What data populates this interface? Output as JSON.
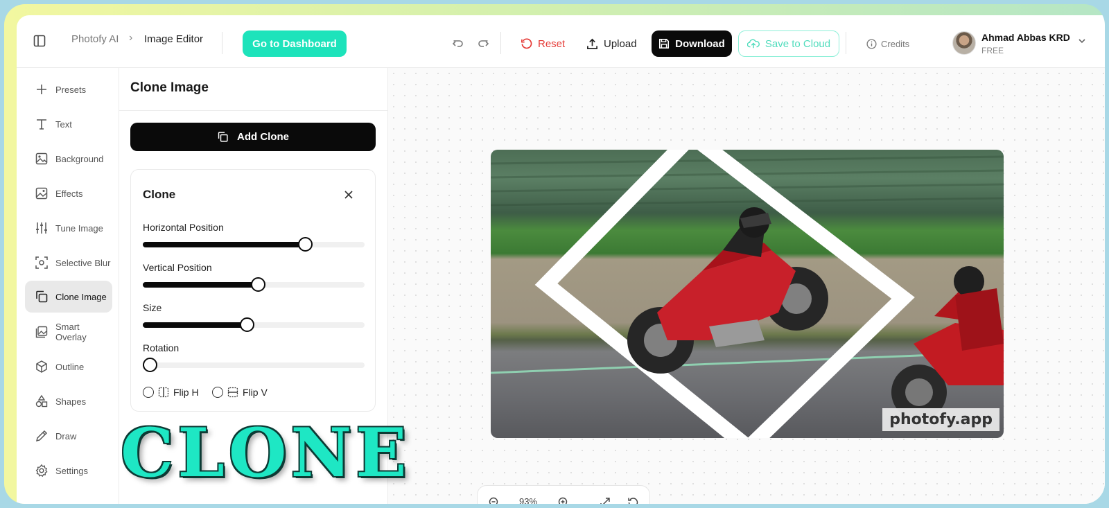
{
  "header": {
    "app_name": "Photofy AI",
    "page_name": "Image Editor",
    "dashboard_button": "Go to Dashboard",
    "reset_label": "Reset",
    "upload_label": "Upload",
    "download_label": "Download",
    "cloud_label": "Save to Cloud",
    "credits_label": "Credits",
    "user_name": "Ahmad Abbas KRD",
    "user_plan": "FREE"
  },
  "sidebar": {
    "items": [
      {
        "label": "Presets",
        "icon": "plus-icon"
      },
      {
        "label": "Text",
        "icon": "text-icon"
      },
      {
        "label": "Background",
        "icon": "image-icon"
      },
      {
        "label": "Effects",
        "icon": "sparkle-image-icon"
      },
      {
        "label": "Tune Image",
        "icon": "sliders-icon"
      },
      {
        "label": "Selective Blur",
        "icon": "focus-icon"
      },
      {
        "label": "Clone Image",
        "icon": "copy-icon",
        "active": true
      },
      {
        "label": "Smart Overlay",
        "icon": "layers-image-icon"
      },
      {
        "label": "Outline",
        "icon": "cube-icon"
      },
      {
        "label": "Shapes",
        "icon": "shapes-icon"
      },
      {
        "label": "Draw",
        "icon": "pencil-icon"
      },
      {
        "label": "Settings",
        "icon": "gear-icon"
      }
    ]
  },
  "panel": {
    "title": "Clone Image",
    "add_clone_label": "Add Clone",
    "card": {
      "title": "Clone",
      "sliders": [
        {
          "label": "Horizontal Position",
          "value": 0.73
        },
        {
          "label": "Vertical Position",
          "value": 0.52
        },
        {
          "label": "Size",
          "value": 0.47
        },
        {
          "label": "Rotation",
          "value": 0.03
        }
      ],
      "flip_h_label": "Flip H",
      "flip_v_label": "Flip V"
    }
  },
  "canvas": {
    "watermark": "photofy.app",
    "zoom": "93%"
  },
  "overlay_text": "CLONE",
  "colors": {
    "accent": "#1de3bb",
    "reset": "#e53935",
    "primary": "#0a0a0a"
  }
}
